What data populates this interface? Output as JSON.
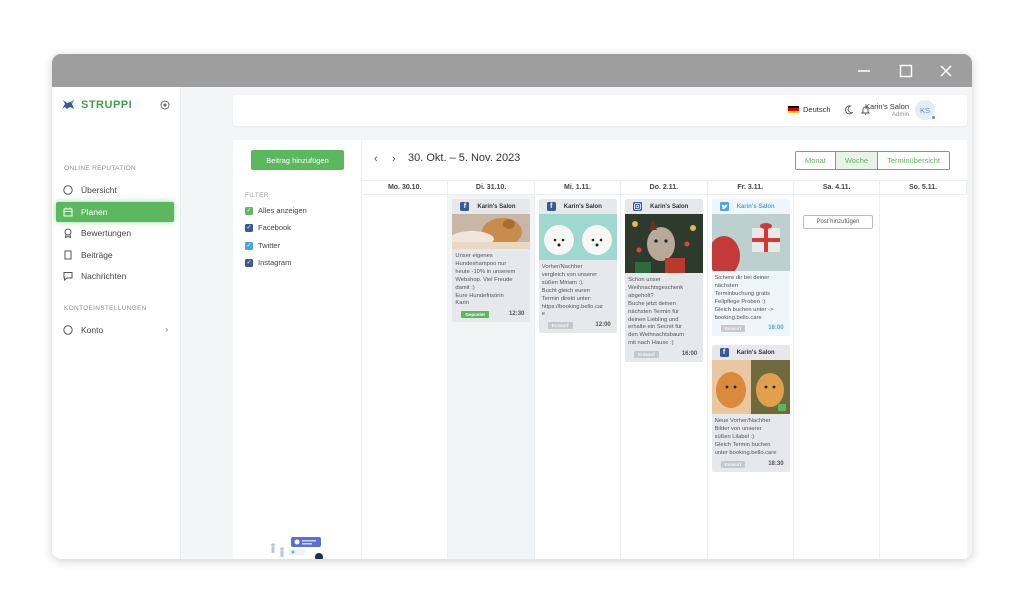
{
  "app": {
    "name": "STRUPPI"
  },
  "window_controls": {
    "minimize": "minimize-icon",
    "maximize": "maximize-icon",
    "close": "close-icon"
  },
  "sidebar": {
    "section_reputation": "ONLINE REPUTATION",
    "items": [
      {
        "label": "Übersicht",
        "icon": "circle-icon"
      },
      {
        "label": "Planen",
        "icon": "calendar-icon",
        "active": true
      },
      {
        "label": "Bewertungen",
        "icon": "award-icon"
      },
      {
        "label": "Beiträge",
        "icon": "document-icon"
      },
      {
        "label": "Nachrichten",
        "icon": "message-icon"
      }
    ],
    "section_account": "KONTOEINSTELLUNGEN",
    "account_item": {
      "label": "Konto",
      "icon": "circle-icon"
    }
  },
  "topbar": {
    "language": "Deutsch",
    "user_name": "Karin's Salon",
    "user_role": "Admin",
    "avatar_initials": "KS"
  },
  "filter": {
    "add_button": "Beitrag hinzufügen",
    "title": "FILTER",
    "options": [
      {
        "label": "Alles anzeigen",
        "color": "#5cb85f"
      },
      {
        "label": "Facebook",
        "color": "#3b5998"
      },
      {
        "label": "Twitter",
        "color": "#4aa3df"
      },
      {
        "label": "Instagram",
        "color": "#3b5998"
      }
    ]
  },
  "calendar": {
    "range": "30. Okt. – 5. Nov. 2023",
    "views": [
      "Monat",
      "Woche",
      "Terminübersicht"
    ],
    "active_view": "Woche",
    "days": [
      "Mo. 30.10.",
      "Di. 31.10.",
      "Mi. 1.11.",
      "Do. 2.11.",
      "Fr. 3.11.",
      "Sa. 4.11.",
      "So. 5.11."
    ],
    "add_post_label": "Post hinzufügen",
    "posts": {
      "tue": {
        "platform": "facebook",
        "account": "Karin's Salon",
        "text": "Unser eigenes\nHundeshampoo nur\nheute -10% in unserem\nWebshop. Viel Freude\ndamit :)\nEure Hundefrisörin\nKarin",
        "status": "Gepostet",
        "time": "12:30"
      },
      "wed": {
        "platform": "facebook",
        "account": "Karin's Salon",
        "text": "Vorher/Nachher\nvergleich von unserer\nsüßen Miriam :).\nBucht gleich euren\nTermin direkt unter:\nhttps://booking.bello.car\ne",
        "status": "Entwurf",
        "time": "12:00"
      },
      "thu": {
        "platform": "instagram",
        "account": "Karin's Salon",
        "text": "Schon unser\nWeihnachtsgeschenk\nabgeholt?\nBuche jetzt deinen\nnächsten Termin für\ndeinen Liebling und\nerhalte ein Secret für\nden Weihnachtsbaum\nmit nach Hause :)",
        "status": "Entwurf",
        "time": "16:00"
      },
      "fri1": {
        "platform": "twitter",
        "account": "Karin's Salon",
        "text": "Sichere dir bei deiner\nnächsten\nTerminbuchung gratis\nFellpflege Proben :)\nGleich buchen unter ->\nbooking.bello.care",
        "status": "Entwurf",
        "time": "16:00"
      },
      "fri2": {
        "platform": "facebook",
        "account": "Karin's Salon",
        "text": "Neue Vorher/Nachher\nBilder von unserer\nsüßen Lilabel :)\nGleich Termin buchen\nunter booking.bello.care",
        "status": "Entwurf",
        "time": "18:30"
      }
    }
  }
}
